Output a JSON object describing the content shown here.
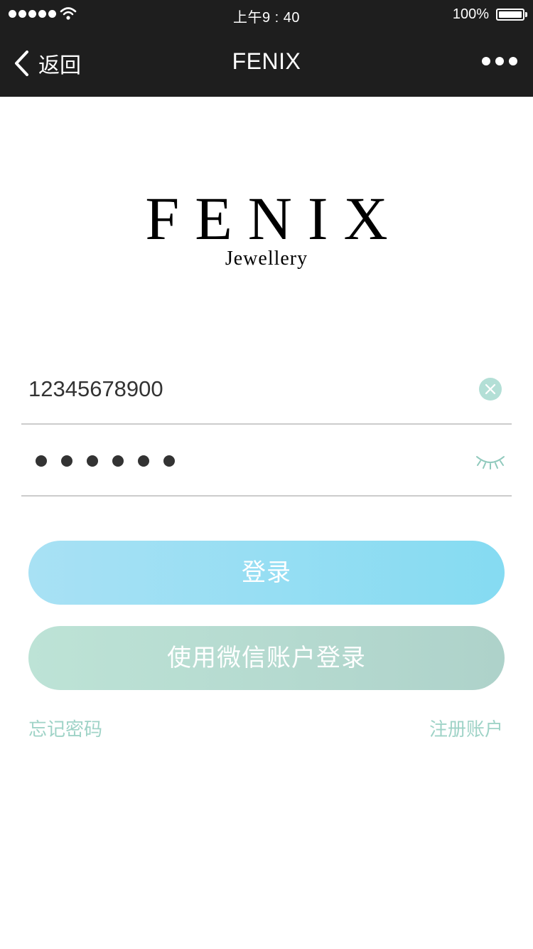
{
  "status_bar": {
    "time": "上午9 : 40",
    "battery": "100%"
  },
  "nav": {
    "back_label": "返回",
    "title": "FENIX"
  },
  "logo": {
    "main": "FENIX",
    "sub": "Jewellery"
  },
  "form": {
    "phone_value": "12345678900",
    "password_masked": "••••••"
  },
  "buttons": {
    "login_label": "登录",
    "wechat_login_label": "使用微信账户登录"
  },
  "links": {
    "forgot_password": "忘记密码",
    "register": "注册账户"
  },
  "colors": {
    "header_bg": "#1e1e1e",
    "login_button": "#85dbf2",
    "wechat_button": "#aed2ca",
    "link": "#9fd3c7"
  }
}
